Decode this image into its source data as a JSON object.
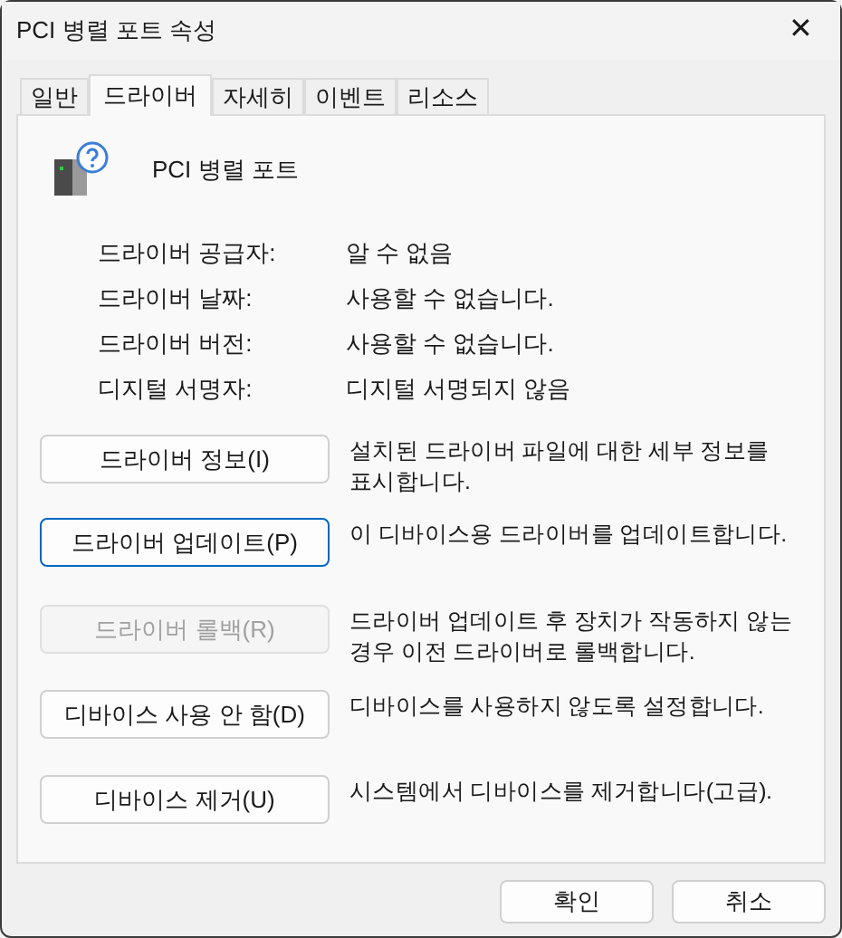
{
  "window": {
    "title": "PCI 병렬 포트 속성",
    "close": "✕"
  },
  "tabs": [
    {
      "label": "일반",
      "selected": false
    },
    {
      "label": "드라이버",
      "selected": true
    },
    {
      "label": "자세히",
      "selected": false
    },
    {
      "label": "이벤트",
      "selected": false
    },
    {
      "label": "리소스",
      "selected": false
    }
  ],
  "device": {
    "name": "PCI 병렬 포트"
  },
  "properties": [
    {
      "label": "드라이버 공급자:",
      "value": "알 수 없음"
    },
    {
      "label": "드라이버 날짜:",
      "value": "사용할 수 없습니다."
    },
    {
      "label": "드라이버 버전:",
      "value": "사용할 수 없습니다."
    },
    {
      "label": "디지털 서명자:",
      "value": "디지털 서명되지 않음"
    }
  ],
  "actions": [
    {
      "button": "드라이버 정보(I)",
      "description": "설치된 드라이버 파일에 대한 세부 정보를 표시합니다.",
      "focused": false,
      "disabled": false
    },
    {
      "button": "드라이버 업데이트(P)",
      "description": "이 디바이스용 드라이버를 업데이트합니다.",
      "focused": true,
      "disabled": false
    },
    {
      "button": "드라이버 롤백(R)",
      "description": "드라이버 업데이트 후 장치가 작동하지 않는 경우 이전 드라이버로 롤백합니다.",
      "focused": false,
      "disabled": true
    },
    {
      "button": "디바이스 사용 안 함(D)",
      "description": "디바이스를 사용하지 않도록 설정합니다.",
      "focused": false,
      "disabled": false
    },
    {
      "button": "디바이스 제거(U)",
      "description": "시스템에서 디바이스를 제거합니다(고급).",
      "focused": false,
      "disabled": false
    }
  ],
  "dialog_buttons": [
    "확인",
    "취소"
  ]
}
